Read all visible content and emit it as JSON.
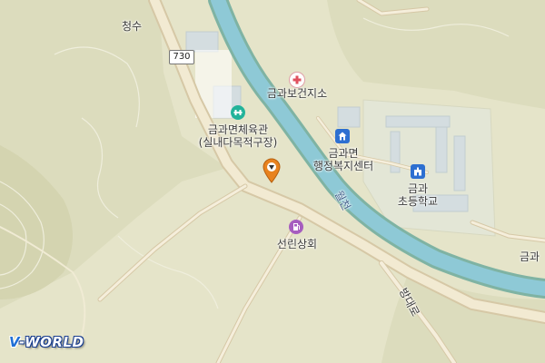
{
  "map": {
    "colors": {
      "land": "#e5e4c9",
      "hill": "#d7d7b3",
      "river": "#8ec9d6",
      "river_edge": "#7fb3a3",
      "road": "#f0e8cf",
      "road_edge": "#d6c8a6",
      "campus": "#dfe6e3"
    },
    "labels": {
      "village": "청수",
      "route_number": "730",
      "health_center": "금과보건지소",
      "gym_line1": "금과면체육관",
      "gym_line2": "(실내다목적구장)",
      "admin_line1": "금과면",
      "admin_line2": "행정복지센터",
      "school_line1": "금과",
      "school_line2": "초등학교",
      "store": "선린상회",
      "stream": "월천",
      "road_name": "방대로",
      "edge_label": "금과"
    },
    "icons": {
      "health_center": "medical-cross-icon",
      "gym": "sports-icon",
      "admin": "government-office-icon",
      "school": "school-icon",
      "store": "gas-station-icon",
      "marker": "location-pin-icon"
    },
    "logo": {
      "prefix": "V",
      "suffix": "-WORLD"
    }
  }
}
